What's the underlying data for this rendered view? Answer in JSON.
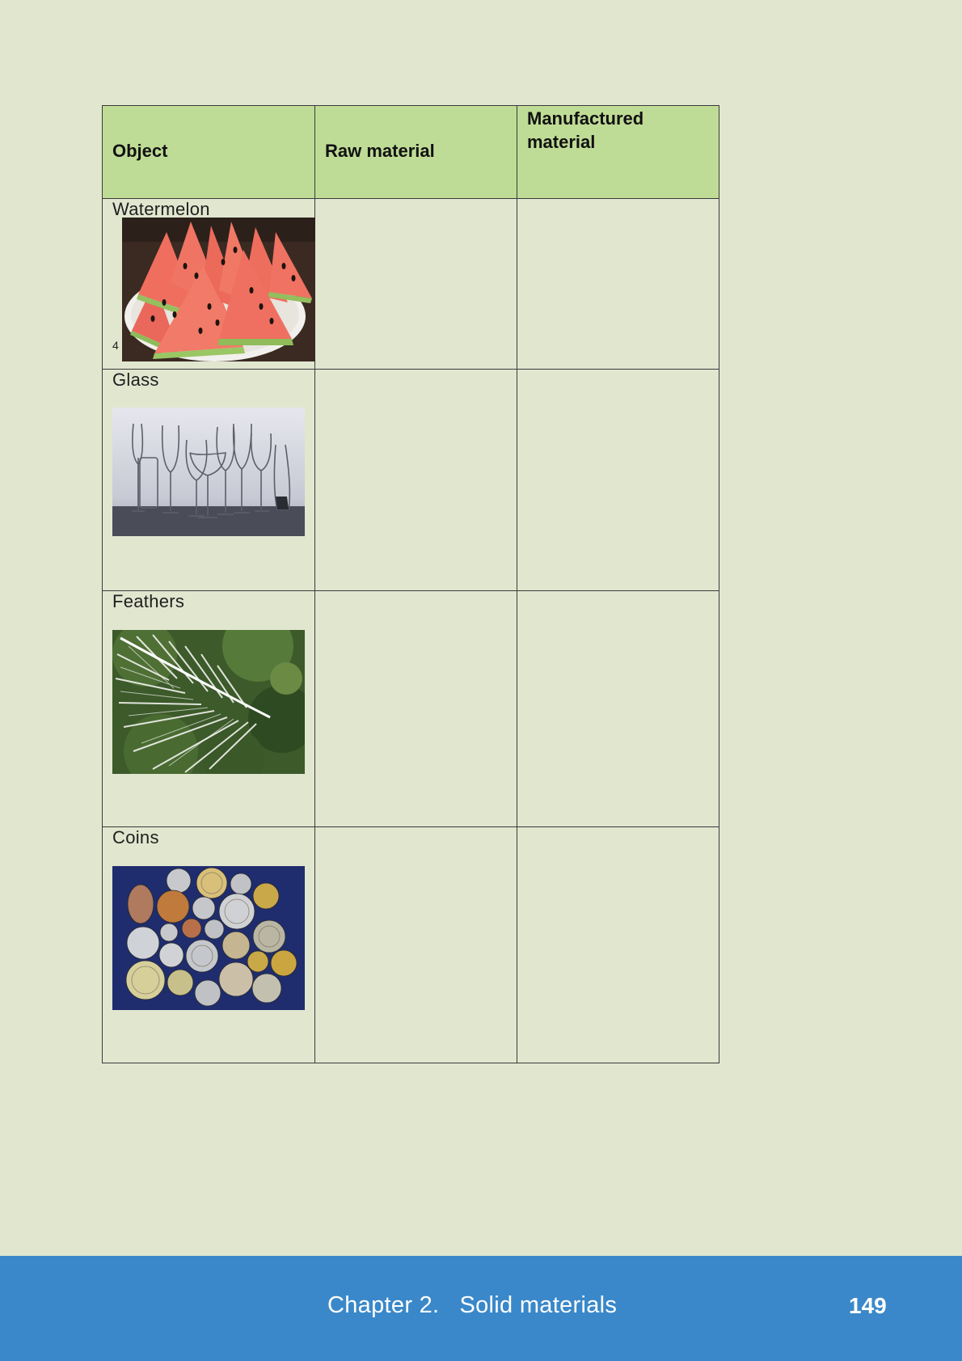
{
  "table": {
    "headers": {
      "object": "Object",
      "raw_material": "Raw material",
      "manufactured_line1": "Manufactured",
      "manufactured_line2": "material"
    },
    "rows": [
      {
        "object": "Watermelon",
        "image": "watermelon-slices-photo",
        "footnote": "4"
      },
      {
        "object": "Glass",
        "image": "drinking-glasses-photo"
      },
      {
        "object": "Feathers",
        "image": "white-feather-photo"
      },
      {
        "object": "Coins",
        "image": "assorted-coins-photo"
      }
    ]
  },
  "footer": {
    "chapter": "Chapter 2.   Solid materials",
    "page_number": "149"
  },
  "colors": {
    "page_background": "#e1e6cf",
    "header_fill": "#bfdc96",
    "footer_band": "#3a88c9"
  }
}
